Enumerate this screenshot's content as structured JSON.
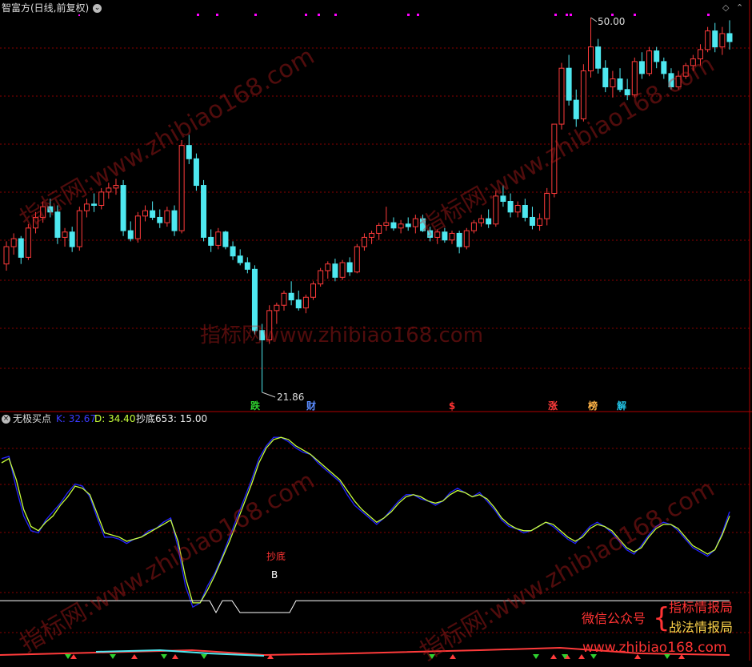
{
  "header": {
    "title": "智富方(日线,前复权)",
    "high_label": "50.00",
    "low_label": "21.86"
  },
  "indicator": {
    "name": "无极买点",
    "k_label": "K: 32.67",
    "d_label": "D: 34.40",
    "s_label": "抄底653: 15.00",
    "signal_text": "抄底",
    "buy_mark": "B"
  },
  "events": [
    {
      "label": "跌",
      "color": "#2fd12f"
    },
    {
      "label": "财",
      "color": "#5a8cff"
    },
    {
      "label": "$",
      "color": "#ff3333"
    },
    {
      "label": "涨",
      "color": "#ff3b3b"
    },
    {
      "label": "榜",
      "color": "#ffb347"
    },
    {
      "label": "解",
      "color": "#22c3e6"
    }
  ],
  "watermarks": {
    "site": "www.zhibiao168.com",
    "brand": "指标网:",
    "brand2": "指标网"
  },
  "promo": {
    "wechat": "微信公众号",
    "account1": "指标情报局",
    "account2": "战法情报局",
    "site": "www.zhibiao168.com"
  },
  "colors": {
    "up": "#ff3b3b",
    "down": "#4ee8f0",
    "k_line": "#2323ff",
    "d_line": "#c8ff3b",
    "grid": "#8a0000",
    "divider": "#b00000",
    "signal": "#ffffff",
    "marker": "#ff00ff"
  },
  "chart_data": [
    {
      "type": "candlestick",
      "title": "智富方(日线,前复权)",
      "annotations": [
        {
          "text": "50.00",
          "value": 50.0
        },
        {
          "text": "21.86",
          "value": 21.86
        }
      ],
      "ohlc": [
        [
          31.5,
          33.2,
          31.0,
          32.8
        ],
        [
          32.8,
          33.8,
          32.2,
          33.4
        ],
        [
          33.4,
          33.6,
          31.5,
          32.0
        ],
        [
          32.0,
          34.5,
          31.8,
          34.2
        ],
        [
          34.2,
          35.4,
          33.8,
          35.0
        ],
        [
          35.0,
          36.2,
          34.6,
          35.8
        ],
        [
          35.8,
          36.4,
          35.0,
          35.4
        ],
        [
          35.4,
          35.9,
          33.0,
          33.5
        ],
        [
          33.5,
          34.2,
          32.8,
          33.9
        ],
        [
          33.9,
          34.3,
          32.4,
          32.8
        ],
        [
          32.8,
          35.8,
          32.5,
          35.5
        ],
        [
          35.5,
          36.4,
          35.0,
          36.0
        ],
        [
          36.0,
          36.8,
          35.4,
          35.9
        ],
        [
          35.9,
          37.2,
          35.6,
          36.9
        ],
        [
          36.9,
          37.6,
          36.4,
          37.2
        ],
        [
          37.2,
          37.9,
          36.7,
          37.4
        ],
        [
          37.4,
          37.8,
          33.6,
          34.0
        ],
        [
          34.0,
          34.7,
          33.2,
          33.4
        ],
        [
          33.4,
          35.4,
          33.1,
          35.1
        ],
        [
          35.1,
          35.9,
          34.7,
          35.5
        ],
        [
          35.5,
          36.2,
          34.8,
          35.0
        ],
        [
          35.0,
          35.6,
          34.2,
          34.6
        ],
        [
          34.6,
          35.8,
          34.3,
          35.5
        ],
        [
          35.5,
          35.9,
          33.6,
          34.0
        ],
        [
          34.0,
          40.8,
          33.8,
          40.4
        ],
        [
          40.4,
          41.2,
          39.0,
          39.4
        ],
        [
          39.4,
          39.8,
          37.0,
          37.4
        ],
        [
          37.4,
          37.8,
          33.2,
          33.5
        ],
        [
          33.5,
          34.1,
          32.4,
          32.9
        ],
        [
          32.9,
          34.2,
          32.6,
          33.9
        ],
        [
          33.9,
          34.0,
          32.6,
          32.8
        ],
        [
          32.8,
          33.2,
          31.8,
          32.1
        ],
        [
          32.1,
          32.6,
          31.4,
          31.6
        ],
        [
          31.6,
          32.0,
          30.8,
          31.1
        ],
        [
          31.1,
          31.4,
          26.2,
          26.5
        ],
        [
          26.5,
          27.0,
          21.86,
          25.8
        ],
        [
          25.8,
          28.4,
          25.5,
          28.0
        ],
        [
          28.0,
          28.6,
          27.0,
          28.4
        ],
        [
          28.4,
          29.5,
          28.0,
          29.3
        ],
        [
          29.3,
          30.2,
          28.4,
          28.8
        ],
        [
          28.8,
          29.5,
          28.0,
          28.2
        ],
        [
          28.2,
          29.2,
          27.8,
          29.0
        ],
        [
          29.0,
          30.2,
          28.8,
          30.0
        ],
        [
          30.0,
          31.2,
          29.8,
          31.0
        ],
        [
          31.0,
          31.7,
          30.4,
          31.5
        ],
        [
          31.5,
          31.9,
          30.2,
          30.5
        ],
        [
          30.5,
          31.8,
          30.3,
          31.6
        ],
        [
          31.6,
          32.0,
          30.6,
          30.9
        ],
        [
          30.9,
          33.0,
          30.8,
          32.8
        ],
        [
          32.8,
          33.8,
          32.5,
          33.5
        ],
        [
          33.5,
          34.0,
          33.0,
          33.8
        ],
        [
          33.8,
          34.6,
          33.3,
          34.4
        ],
        [
          34.4,
          35.8,
          34.0,
          34.6
        ],
        [
          34.6,
          35.0,
          34.0,
          34.2
        ],
        [
          34.2,
          34.8,
          33.8,
          34.5
        ],
        [
          34.5,
          35.0,
          34.0,
          34.3
        ],
        [
          34.3,
          35.2,
          33.8,
          34.9
        ],
        [
          34.9,
          35.2,
          33.9,
          34.0
        ],
        [
          34.0,
          34.3,
          33.2,
          33.5
        ],
        [
          33.5,
          34.1,
          33.0,
          33.9
        ],
        [
          33.9,
          34.2,
          33.1,
          33.3
        ],
        [
          33.3,
          34.0,
          33.0,
          33.8
        ],
        [
          33.8,
          34.0,
          32.3,
          32.8
        ],
        [
          32.8,
          34.2,
          32.6,
          34.0
        ],
        [
          34.0,
          34.8,
          33.8,
          34.6
        ],
        [
          34.6,
          35.2,
          34.3,
          34.9
        ],
        [
          34.9,
          35.6,
          34.2,
          34.5
        ],
        [
          34.5,
          37.0,
          34.3,
          36.6
        ],
        [
          36.6,
          37.4,
          35.8,
          36.2
        ],
        [
          36.2,
          36.8,
          35.0,
          35.4
        ],
        [
          35.4,
          36.2,
          35.0,
          35.9
        ],
        [
          35.9,
          36.4,
          34.7,
          35.0
        ],
        [
          35.0,
          35.8,
          34.1,
          34.4
        ],
        [
          34.4,
          35.3,
          34.0,
          34.9
        ],
        [
          34.9,
          37.2,
          34.4,
          36.8
        ],
        [
          36.8,
          42.0,
          36.5,
          42.0
        ],
        [
          42.0,
          46.6,
          41.6,
          46.2
        ],
        [
          46.2,
          47.2,
          43.4,
          43.8
        ],
        [
          43.8,
          44.6,
          41.8,
          42.4
        ],
        [
          42.4,
          46.5,
          42.2,
          46.0
        ],
        [
          46.0,
          50.0,
          45.5,
          47.8
        ],
        [
          47.8,
          48.4,
          45.8,
          46.2
        ],
        [
          46.2,
          46.8,
          44.4,
          44.8
        ],
        [
          44.8,
          46.0,
          44.0,
          45.4
        ],
        [
          45.4,
          46.2,
          44.4,
          44.6
        ],
        [
          44.6,
          45.4,
          43.8,
          44.2
        ],
        [
          44.2,
          47.0,
          44.0,
          46.7
        ],
        [
          46.7,
          47.4,
          45.4,
          45.8
        ],
        [
          45.8,
          47.8,
          45.6,
          47.5
        ],
        [
          47.5,
          47.8,
          46.2,
          46.7
        ],
        [
          46.7,
          47.0,
          45.4,
          45.8
        ],
        [
          45.8,
          46.2,
          44.6,
          44.8
        ],
        [
          44.8,
          46.0,
          44.6,
          45.6
        ],
        [
          45.6,
          46.6,
          45.4,
          46.4
        ],
        [
          46.4,
          47.2,
          46.0,
          46.9
        ],
        [
          46.9,
          48.0,
          46.4,
          47.6
        ],
        [
          47.6,
          49.3,
          47.4,
          49.0
        ],
        [
          49.0,
          49.6,
          47.4,
          47.8
        ],
        [
          47.8,
          49.3,
          47.2,
          48.8
        ],
        [
          48.8,
          49.8,
          47.6,
          48.2
        ]
      ]
    },
    {
      "type": "line",
      "title": "无极买点",
      "series": [
        {
          "name": "K",
          "values": [
            82,
            83,
            68,
            55,
            48,
            47,
            53,
            57,
            61,
            66,
            70,
            69,
            64,
            54,
            45,
            45,
            44,
            42,
            44,
            45,
            48,
            49,
            52,
            54,
            40,
            22,
            12,
            14,
            22,
            28,
            36,
            45,
            54,
            63,
            72,
            82,
            88,
            92,
            92,
            90,
            87,
            85,
            84,
            80,
            77,
            74,
            71,
            65,
            60,
            57,
            54,
            51,
            54,
            58,
            62,
            65,
            65,
            63,
            62,
            60,
            62,
            66,
            68,
            66,
            64,
            66,
            62,
            58,
            53,
            50,
            49,
            47,
            48,
            50,
            52,
            50,
            47,
            44,
            42,
            46,
            50,
            52,
            50,
            47,
            43,
            39,
            37,
            41,
            46,
            50,
            52,
            51,
            48,
            44,
            40,
            38,
            36,
            39,
            47,
            57
          ]
        },
        {
          "name": "D",
          "values": [
            80,
            82,
            72,
            58,
            50,
            48,
            52,
            55,
            60,
            64,
            69,
            68,
            65,
            56,
            47,
            46,
            45,
            43,
            44,
            45,
            47,
            49,
            51,
            53,
            43,
            26,
            14,
            14,
            20,
            27,
            35,
            43,
            52,
            61,
            70,
            80,
            87,
            91,
            92,
            91,
            88,
            86,
            84,
            81,
            78,
            75,
            72,
            67,
            62,
            58,
            55,
            52,
            54,
            57,
            61,
            64,
            65,
            64,
            62,
            61,
            62,
            65,
            67,
            66,
            64,
            65,
            63,
            59,
            54,
            51,
            49,
            48,
            48,
            50,
            52,
            51,
            48,
            45,
            43,
            45,
            49,
            51,
            50,
            48,
            44,
            40,
            38,
            40,
            45,
            49,
            51,
            51,
            49,
            45,
            41,
            39,
            37,
            39,
            46,
            55
          ]
        },
        {
          "name": "抄底653",
          "value": 15.0
        }
      ],
      "ylim": [
        0,
        100
      ],
      "signals": [
        {
          "text": "抄底"
        },
        {
          "text": "B"
        }
      ]
    }
  ]
}
